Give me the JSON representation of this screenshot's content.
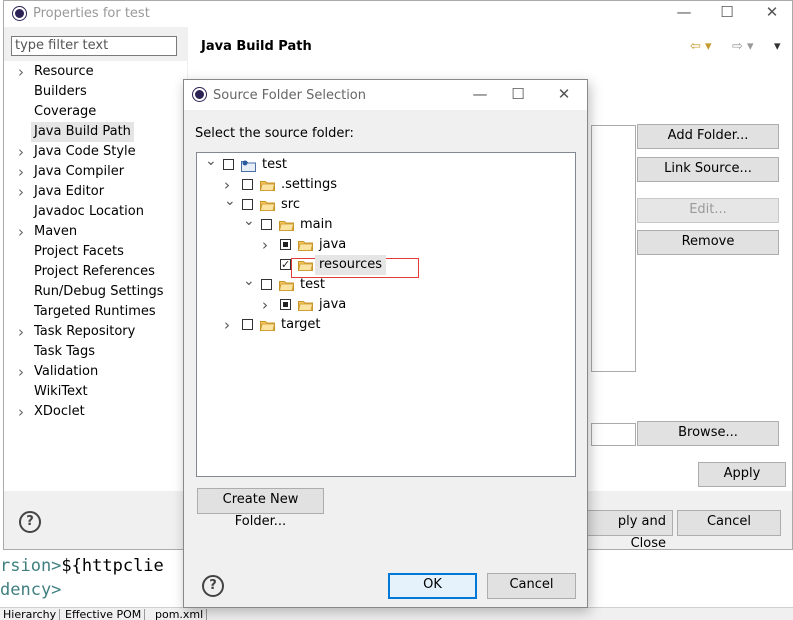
{
  "background": {
    "code_line_1_tag": "rsion>",
    "code_line_1_text": "${httpclie",
    "code_line_2": "dency>",
    "bottom_tabs": [
      "Hierarchy",
      "Effective POM",
      "pom.xml"
    ]
  },
  "properties_window": {
    "title": "Properties for test",
    "filter_placeholder": "type filter text",
    "page_title": "Java Build Path",
    "nav_items": [
      {
        "label": "Resource",
        "expandable": true
      },
      {
        "label": "Builders",
        "expandable": false
      },
      {
        "label": "Coverage",
        "expandable": false
      },
      {
        "label": "Java Build Path",
        "expandable": false,
        "selected": true
      },
      {
        "label": "Java Code Style",
        "expandable": true
      },
      {
        "label": "Java Compiler",
        "expandable": true
      },
      {
        "label": "Java Editor",
        "expandable": true
      },
      {
        "label": "Javadoc Location",
        "expandable": false
      },
      {
        "label": "Maven",
        "expandable": true
      },
      {
        "label": "Project Facets",
        "expandable": false
      },
      {
        "label": "Project References",
        "expandable": false
      },
      {
        "label": "Run/Debug Settings",
        "expandable": false
      },
      {
        "label": "Targeted Runtimes",
        "expandable": false
      },
      {
        "label": "Task Repository",
        "expandable": true
      },
      {
        "label": "Task Tags",
        "expandable": false
      },
      {
        "label": "Validation",
        "expandable": true
      },
      {
        "label": "WikiText",
        "expandable": false
      },
      {
        "label": "XDoclet",
        "expandable": true
      }
    ],
    "buttons": {
      "add_folder": "Add Folder...",
      "link_source": "Link Source...",
      "edit": "Edit...",
      "remove": "Remove",
      "browse": "Browse...",
      "apply": "Apply",
      "apply_and_close": "ply and Close",
      "cancel": "Cancel"
    }
  },
  "dialog": {
    "title": "Source Folder Selection",
    "prompt": "Select the source folder:",
    "tree": [
      {
        "label": "test",
        "depth": 0,
        "twisty": "open",
        "check": "none",
        "icon": "project"
      },
      {
        "label": ".settings",
        "depth": 1,
        "twisty": "closed",
        "check": "none",
        "icon": "folder"
      },
      {
        "label": "src",
        "depth": 1,
        "twisty": "open",
        "check": "none",
        "icon": "folder"
      },
      {
        "label": "main",
        "depth": 2,
        "twisty": "open",
        "check": "none",
        "icon": "folder"
      },
      {
        "label": "java",
        "depth": 3,
        "twisty": "closed",
        "check": "partial",
        "icon": "folder"
      },
      {
        "label": "resources",
        "depth": 3,
        "twisty": "none",
        "check": "checked",
        "icon": "folder",
        "selected": true
      },
      {
        "label": "test",
        "depth": 2,
        "twisty": "open",
        "check": "none",
        "icon": "folder"
      },
      {
        "label": "java",
        "depth": 3,
        "twisty": "closed",
        "check": "partial",
        "icon": "folder"
      },
      {
        "label": "target",
        "depth": 1,
        "twisty": "closed",
        "check": "none",
        "icon": "folder"
      }
    ],
    "buttons": {
      "create_new_folder": "Create New Folder...",
      "ok": "OK",
      "cancel": "Cancel"
    },
    "help": "?"
  },
  "colors": {
    "accent": "#0078d7",
    "folder": "#f4c65d",
    "highlight_box": "#e03c3c"
  }
}
